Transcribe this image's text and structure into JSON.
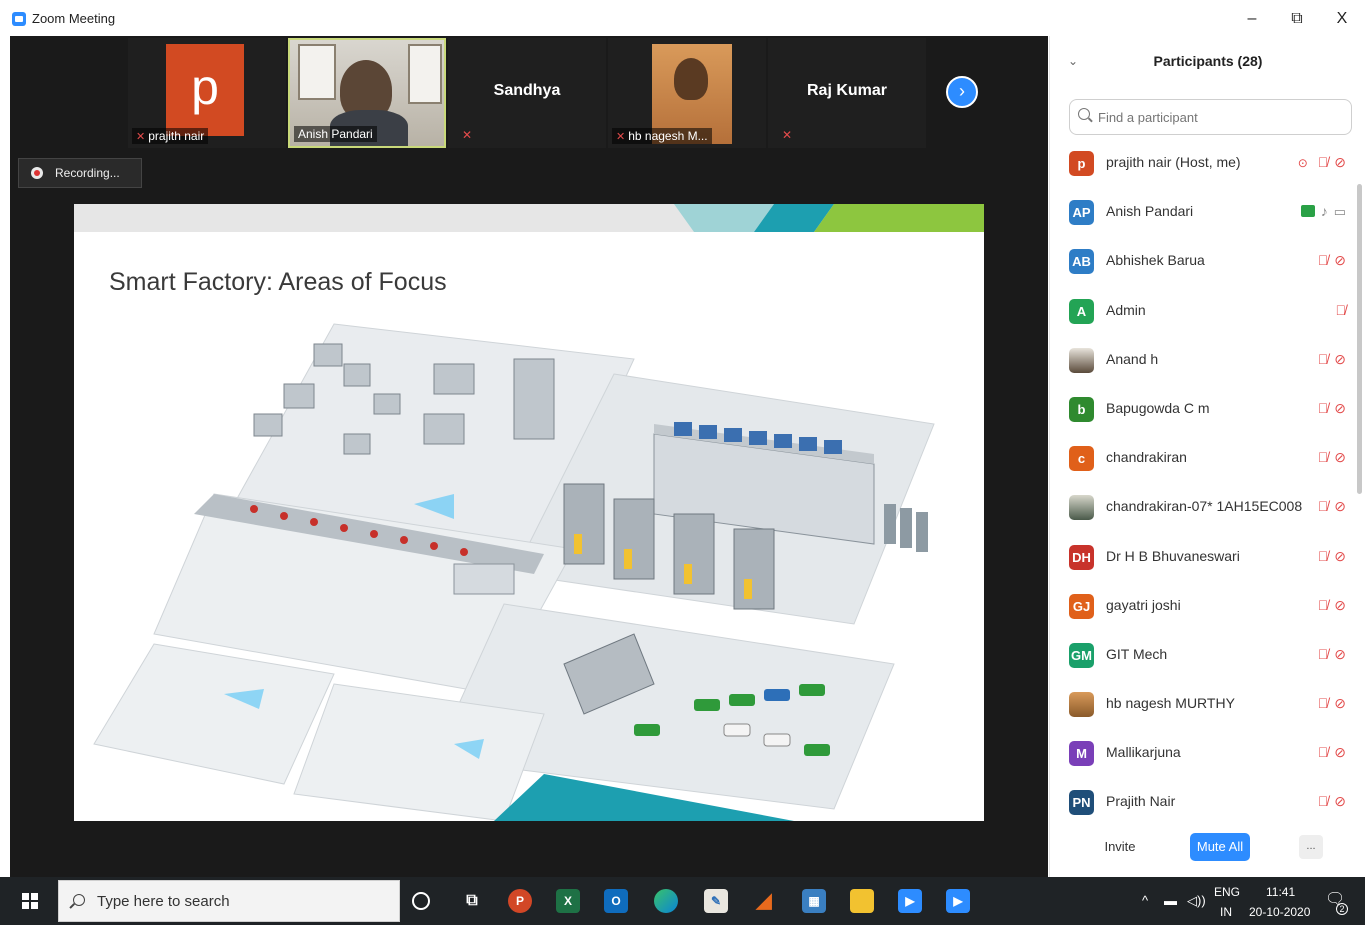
{
  "window": {
    "title": "Zoom Meeting",
    "controls": {
      "minimize": "–",
      "restore": "⧉",
      "close": "X"
    }
  },
  "recording": {
    "label": "Recording..."
  },
  "thumbnails": [
    {
      "name": "prajith nair",
      "avatar_letter": "p",
      "muted": true
    },
    {
      "name": "Anish Pandari",
      "muted": false,
      "video": true
    },
    {
      "name": "Sandhya",
      "muted": true
    },
    {
      "name": "hb nagesh M...",
      "muted": true,
      "video": true
    },
    {
      "name": "Raj Kumar",
      "muted": true
    }
  ],
  "slide": {
    "title": "Smart Factory: Areas of Focus"
  },
  "participants": {
    "title": "Participants (28)",
    "search_placeholder": "Find a participant",
    "list": [
      {
        "initials": "p",
        "name": "prajith nair (Host, me)",
        "color": "#d24a22",
        "host": true
      },
      {
        "initials": "AP",
        "name": "Anish Pandari",
        "color": "#2e7dc6",
        "sharing": true
      },
      {
        "initials": "AB",
        "name": "Abhishek Barua",
        "color": "#2e7dc6"
      },
      {
        "initials": "A",
        "name": "Admin",
        "color": "#23a455"
      },
      {
        "initials": "",
        "name": "Anand h",
        "color": "#5a4a3a",
        "photo": true
      },
      {
        "initials": "b",
        "name": "Bapugowda C m",
        "color": "#2f8a2f"
      },
      {
        "initials": "c",
        "name": "chandrakiran",
        "color": "#e0601a"
      },
      {
        "initials": "",
        "name": "chandrakiran-07* 1AH15EC008",
        "color": "#8a8a7a",
        "photo": true
      },
      {
        "initials": "DH",
        "name": "Dr H B Bhuvaneswari",
        "color": "#c8332b"
      },
      {
        "initials": "GJ",
        "name": "gayatri joshi",
        "color": "#e0601a"
      },
      {
        "initials": "GM",
        "name": "GIT Mech",
        "color": "#1aa06a"
      },
      {
        "initials": "",
        "name": "hb nagesh MURTHY",
        "color": "#b0703a",
        "photo": true
      },
      {
        "initials": "M",
        "name": "Mallikarjuna",
        "color": "#7a3fb8"
      },
      {
        "initials": "PN",
        "name": "Prajith Nair",
        "color": "#1f4e79"
      }
    ],
    "invite_label": "Invite",
    "mute_all_label": "Mute All",
    "more_label": "..."
  },
  "taskbar": {
    "search_placeholder": "Type here to search",
    "apps": [
      "cortana-icon",
      "task-view-icon",
      "powerpoint-icon",
      "excel-icon",
      "outlook-icon",
      "edge-icon",
      "paint-icon",
      "matlab-icon",
      "calculator-icon",
      "file-explorer-icon",
      "zoom-icon",
      "zoom-meeting-icon"
    ],
    "lang_top": "ENG",
    "lang_bottom": "IN",
    "time": "11:41",
    "date": "20-10-2020",
    "notifications": "2"
  }
}
